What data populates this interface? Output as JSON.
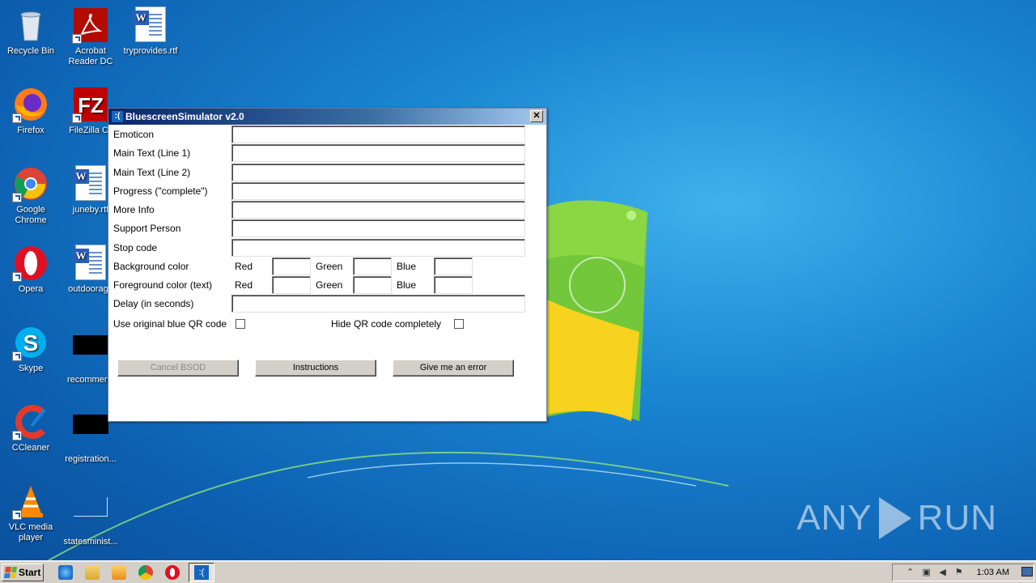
{
  "desktop": {
    "icons": [
      {
        "label": "Recycle Bin"
      },
      {
        "label": "Acrobat Reader DC"
      },
      {
        "label": "tryprovides.rtf"
      },
      {
        "label": "Firefox"
      },
      {
        "label": "FileZilla Cli"
      },
      {
        "label": "Google Chrome"
      },
      {
        "label": "juneby.rtf"
      },
      {
        "label": "Opera"
      },
      {
        "label": "outdoorage"
      },
      {
        "label": "Skype"
      },
      {
        "label": "recommend"
      },
      {
        "label": "CCleaner"
      },
      {
        "label": "registration..."
      },
      {
        "label": "VLC media player"
      },
      {
        "label": "statesminist..."
      }
    ],
    "watermark": {
      "left": "ANY",
      "right": "RUN"
    }
  },
  "window": {
    "title": "BluescreenSimulator v2.0",
    "icon_glyph": ":(",
    "close_glyph": "✕",
    "fields": [
      {
        "label": "Emoticon",
        "value": ""
      },
      {
        "label": "Main Text (Line 1)",
        "value": ""
      },
      {
        "label": "Main Text (Line 2)",
        "value": ""
      },
      {
        "label": "Progress (\"complete\")",
        "value": ""
      },
      {
        "label": "More Info",
        "value": ""
      },
      {
        "label": "Support Person",
        "value": ""
      },
      {
        "label": "Stop code",
        "value": ""
      }
    ],
    "background_color": {
      "label": "Background color",
      "red": "Red",
      "green": "Green",
      "blue": "Blue"
    },
    "foreground_color": {
      "label": "Foreground color (text)",
      "red": "Red",
      "green": "Green",
      "blue": "Blue"
    },
    "delay": {
      "label": "Delay (in seconds)",
      "value": ""
    },
    "use_original_qr": {
      "label": "Use original blue QR code",
      "checked": false
    },
    "hide_qr": {
      "label": "Hide QR code completely",
      "checked": false
    },
    "buttons": {
      "cancel": "Cancel BSOD",
      "instructions": "Instructions",
      "error": "Give me an error"
    }
  },
  "taskbar": {
    "start_label": "Start",
    "active_app_glyph": ":(",
    "clock": "1:03 AM"
  }
}
